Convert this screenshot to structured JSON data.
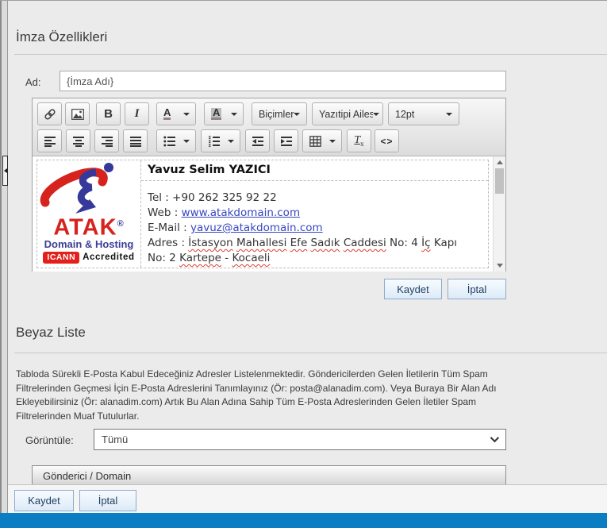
{
  "colors": {
    "page_bg": "#ebebeb",
    "bottom_bar_blue": "#0b7dc2",
    "brand_red": "#d6231e",
    "brand_navy": "#3c3f94",
    "link_blue": "#3847c0",
    "spellcheck_red": "#e03c31"
  },
  "signature": {
    "title": "İmza Özellikleri",
    "name_label": "Ad:",
    "name_value": "{İmza Adı}",
    "save_label": "Kaydet",
    "cancel_label": "İptal"
  },
  "toolbar": {
    "bold": "B",
    "italic": "I",
    "forecolor_letter": "A",
    "backcolor_letter": "A",
    "formats": "Biçimler",
    "font_family": "Yazıtipi Ailesi",
    "font_size": "12pt",
    "source_code": "<>"
  },
  "editor": {
    "content": {
      "name": "Yavuz Selim YAZICI",
      "lines": [
        [
          {
            "t": "Tel : +90 262 325 92 22",
            "s": "plain"
          }
        ],
        [
          {
            "t": "Web : ",
            "s": "plain"
          },
          {
            "t": "www.atakdomain.com",
            "s": "link"
          }
        ],
        [
          {
            "t": "E-Mail : ",
            "s": "plain"
          },
          {
            "t": "yavuz@atakdomain.com",
            "s": "link"
          }
        ],
        [
          {
            "t": "Adres : ",
            "s": "plain"
          },
          {
            "t": "İstasyon",
            "s": "wavy"
          },
          {
            "t": " ",
            "s": "plain"
          },
          {
            "t": "Mahallesi",
            "s": "wavy"
          },
          {
            "t": " ",
            "s": "plain"
          },
          {
            "t": "Efe",
            "s": "wavy"
          },
          {
            "t": " ",
            "s": "plain"
          },
          {
            "t": "Sadık",
            "s": "wavy"
          },
          {
            "t": " ",
            "s": "plain"
          },
          {
            "t": "Caddesi",
            "s": "wavy"
          },
          {
            "t": " No: 4 ",
            "s": "plain"
          },
          {
            "t": "İç",
            "s": "wavy"
          },
          {
            "t": " Kapı",
            "s": "plain"
          }
        ],
        [
          {
            "t": "No: 2 ",
            "s": "plain"
          },
          {
            "t": "Kartepe",
            "s": "wavy"
          },
          {
            "t": " - ",
            "s": "plain"
          },
          {
            "t": "Kocaeli",
            "s": "wavy"
          }
        ]
      ],
      "logo": {
        "brand": "ATAK",
        "registered": "®",
        "tagline": "Domain & Hosting",
        "badge": "ICANN",
        "badge_suffix": "Accredited"
      }
    }
  },
  "whitelist": {
    "title": "Beyaz Liste",
    "description": "Tabloda Sürekli E-Posta Kabul Edeceğiniz Adresler Listelenmektedir. Göndericilerden Gelen İletilerin Tüm Spam Filtrelerinden Geçmesi İçin E-Posta Adreslerini Tanımlayınız (Ör: posta@alanadim.com). Veya Buraya Bir Alan Adı Ekleyebilirsiniz (Ör: alanadim.com) Artık Bu Alan Adına Sahip Tüm E-Posta Adreslerinden Gelen İletiler Spam Filtrelerinden Muaf Tutulurlar.",
    "display_label": "Görüntüle:",
    "display_value": "Tümü",
    "table_header": "Gönderici / Domain"
  },
  "footer": {
    "save_label": "Kaydet",
    "cancel_label": "İptal"
  }
}
